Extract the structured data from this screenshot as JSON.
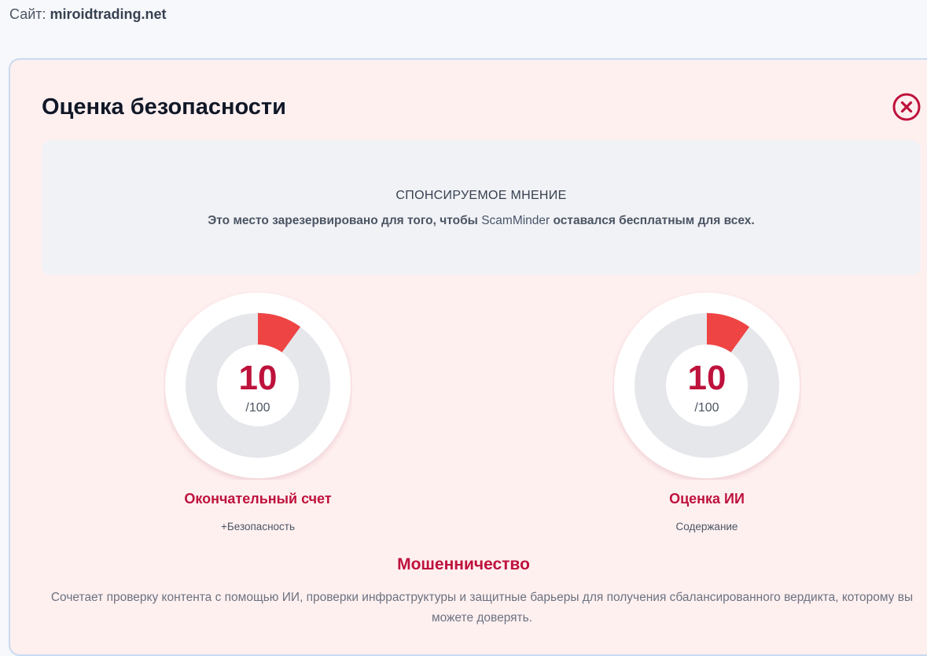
{
  "site": {
    "label": "Сайт:",
    "domain": "miroidtrading.net"
  },
  "card": {
    "title": "Оценка безопасности",
    "close_icon": "close-circle-icon",
    "accent_color": "#be123c",
    "background_color": "#fff0f0"
  },
  "sponsor": {
    "heading": "СПОНСИРУЕМОЕ МНЕНИЕ",
    "text_before": "Это место зарезервировано для того, чтобы",
    "brand": "ScamMinder",
    "text_after": "оставался бесплатным для всех."
  },
  "gauges": [
    {
      "score": "10",
      "max": "/100",
      "value": 10,
      "label": "Окончательный счет",
      "sublabel": "+Безопасность",
      "fill_color": "#ef4444",
      "track_color": "#e5e7eb"
    },
    {
      "score": "10",
      "max": "/100",
      "value": 10,
      "label": "Оценка ИИ",
      "sublabel": "Содержание",
      "fill_color": "#ef4444",
      "track_color": "#e5e7eb"
    }
  ],
  "verdict": "Мошенничество",
  "description": "Сочетает проверку контента с помощью ИИ, проверки инфраструктуры и защитные барьеры для получения сбалансированного вердикта, которому вы можете доверять."
}
